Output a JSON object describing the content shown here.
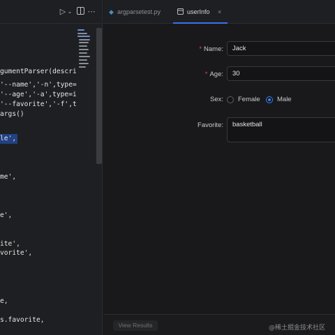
{
  "editor": {
    "toolbar": {
      "run_icon": "run-icon",
      "split_icon": "split-editor-icon",
      "more_icon": "more-icon"
    },
    "code_lines": [
      "gumentParser(descrip",
      "'--name','-n',type=s",
      "'--age','-a',type=in",
      "'--favorite','-f',ty",
      "args()",
      "le',",
      "me',",
      "e',",
      "ite',",
      "vorite',",
      "e,",
      "s.favorite,"
    ]
  },
  "tabs": [
    {
      "label": "argparsetest.py",
      "icon": "python-file-icon"
    },
    {
      "label": "userInfo",
      "icon": "window-icon",
      "close_icon": "close-icon"
    }
  ],
  "form": {
    "name_label": "Name:",
    "name_value": "Jack",
    "age_label": "Age:",
    "age_value": "30",
    "sex_label": "Sex:",
    "sex_options": [
      "Female",
      "Male"
    ],
    "sex_selected": "Male",
    "favorite_label": "Favorite:",
    "favorite_value": "basketball",
    "required_mark": "*"
  },
  "footer": {
    "view_results_label": "View Results",
    "watermark": "@稀土掘金技术社区"
  },
  "colors": {
    "accent": "#3b82f6",
    "required": "#e5484d",
    "selection": "#214283"
  }
}
